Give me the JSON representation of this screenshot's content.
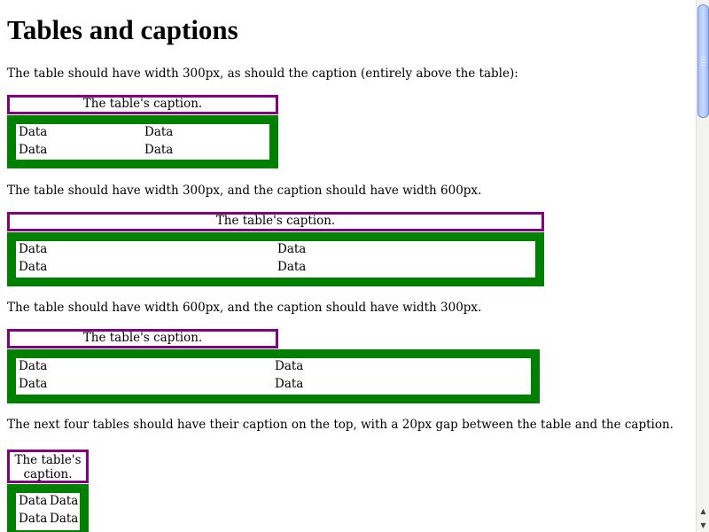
{
  "page": {
    "title": "Tables and captions",
    "paragraphs": [
      "The table should have width 300px, as should the caption (entirely above the table):",
      "The table should have width 300px, and the caption should have width 600px.",
      "The table should have width 600px, and the caption should have width 300px.",
      "The next four tables should have their caption on the top, with a 20px gap between the table and the caption."
    ],
    "caption_text": "The table's caption.",
    "cell_text": "Data"
  },
  "colors": {
    "caption_border": "#800080",
    "table_border": "#008000",
    "scrollbar_thumb": "#b4cbff"
  },
  "scrollbar": {
    "up_icon": "arrow-up-icon",
    "down_icon": "arrow-down-icon"
  }
}
